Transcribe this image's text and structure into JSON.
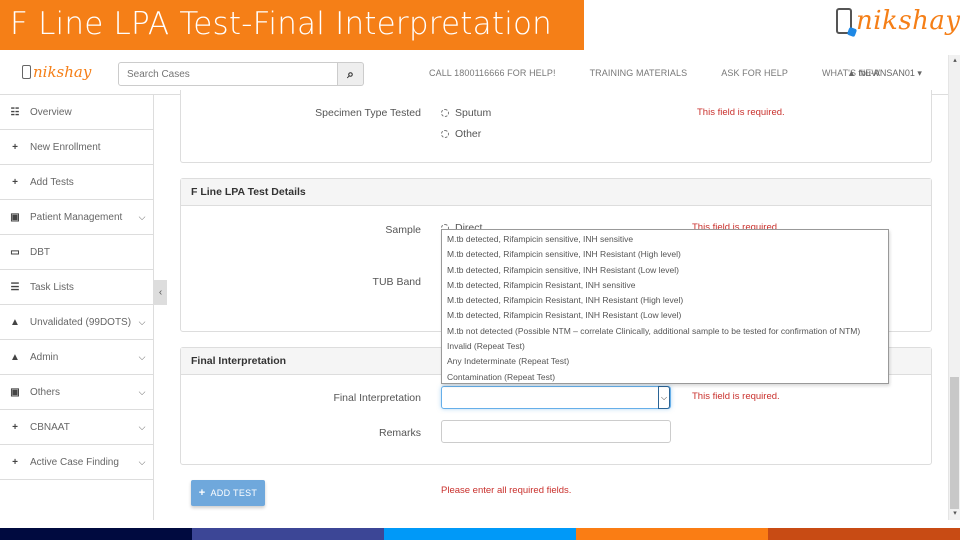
{
  "slide": {
    "title": "F Line LPA Test-Final Interpretation",
    "brand": "nikshay"
  },
  "colors": {
    "title_bg": "#f57f17",
    "brand_orange": "#f57f17",
    "error_red": "#c9302c",
    "button_blue": "#6fa8dc",
    "footer": [
      "#000a3f",
      "#3c4696",
      "#0099f8",
      "#fa7d14",
      "#c84b14"
    ]
  },
  "navbar": {
    "logo_text": "nikshay",
    "search_placeholder": "Search Cases",
    "search_icon": "search-icon",
    "links": [
      "CALL 1800116666 FOR HELP!",
      "TRAINING MATERIALS",
      "ASK FOR HELP",
      "WHAT'S NEW"
    ],
    "user": "▲ tbu-ANSAN01 ▾"
  },
  "sidebar": {
    "items": [
      {
        "icon": "☷",
        "label": "Overview",
        "chevron": ""
      },
      {
        "icon": "+",
        "label": "New Enrollment",
        "chevron": ""
      },
      {
        "icon": "+",
        "label": "Add Tests",
        "chevron": ""
      },
      {
        "icon": "▣",
        "label": "Patient Management",
        "chevron": "⌵"
      },
      {
        "icon": "▭",
        "label": "DBT",
        "chevron": ""
      },
      {
        "icon": "☰",
        "label": "Task Lists",
        "chevron": ""
      },
      {
        "icon": "▲",
        "label": "Unvalidated (99DOTS)",
        "chevron": "⌵"
      },
      {
        "icon": "▲",
        "label": "Admin",
        "chevron": "⌵"
      },
      {
        "icon": "▣",
        "label": "Others",
        "chevron": "⌵"
      },
      {
        "icon": "+",
        "label": "CBNAAT",
        "chevron": "⌵"
      },
      {
        "icon": "+",
        "label": "Active Case Finding",
        "chevron": "⌵"
      }
    ],
    "collapse_glyph": "‹"
  },
  "form": {
    "specimen": {
      "label": "Specimen Type Tested",
      "options": [
        "Sputum",
        "Other"
      ],
      "error": "This field is required."
    },
    "lpa_details": {
      "heading": "F Line LPA Test Details",
      "sample_label": "Sample",
      "sample_option": "Direct",
      "sample_error": "This field is required.",
      "tub_band_label": "TUB Band"
    },
    "final": {
      "heading": "Final Interpretation",
      "label": "Final Interpretation",
      "value": "",
      "error": "This field is required.",
      "remarks_label": "Remarks",
      "remarks_value": "",
      "dropdown_options": [
        "M.tb detected, Rifampicin sensitive, INH sensitive",
        "M.tb detected, Rifampicin sensitive, INH Resistant (High level)",
        "M.tb detected, Rifampicin sensitive, INH Resistant (Low level)",
        "M.tb detected, Rifampicin Resistant, INH sensitive",
        "M.tb detected, Rifampicin Resistant, INH Resistant (High level)",
        "M.tb detected, Rifampicin Resistant, INH Resistant (Low level)",
        "M.tb not detected (Possible NTM – correlate Clinically, additional sample to be tested for confirmation of NTM)",
        "Invalid (Repeat Test)",
        "Any Indeterminate (Repeat Test)",
        "Contamination (Repeat Test)"
      ]
    },
    "add_test_label": "ADD TEST",
    "global_error": "Please enter all required fields."
  }
}
